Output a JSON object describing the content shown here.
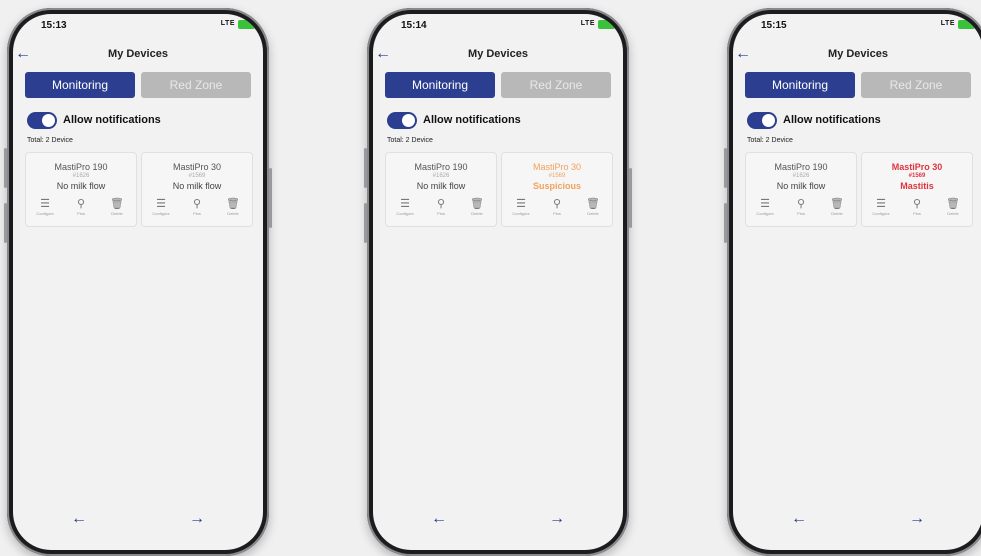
{
  "screens": [
    {
      "time": "15:13",
      "signal": "LTE",
      "title": "My Devices",
      "tabs": [
        "Monitoring",
        "Red Zone"
      ],
      "toggle_label": "Allow notifications",
      "total": "Total: 2 Device",
      "cards": [
        {
          "name": "MastiPro 190",
          "code": "#1626",
          "status": "No milk flow",
          "state": "normal"
        },
        {
          "name": "MastiPro 30",
          "code": "#1569",
          "status": "No milk flow",
          "state": "normal"
        }
      ]
    },
    {
      "time": "15:14",
      "signal": "LTE",
      "title": "My Devices",
      "tabs": [
        "Monitoring",
        "Red Zone"
      ],
      "toggle_label": "Allow notifications",
      "total": "Total: 2 Device",
      "cards": [
        {
          "name": "MastiPro 190",
          "code": "#1626",
          "status": "No milk flow",
          "state": "normal"
        },
        {
          "name": "MastiPro 30",
          "code": "#1569",
          "status": "Suspicious",
          "state": "suspicious"
        }
      ]
    },
    {
      "time": "15:15",
      "signal": "LTE",
      "title": "My Devices",
      "tabs": [
        "Monitoring",
        "Red Zone"
      ],
      "toggle_label": "Allow notifications",
      "total": "Total: 2 Device",
      "cards": [
        {
          "name": "MastiPro 190",
          "code": "#1626",
          "status": "No milk flow",
          "state": "normal"
        },
        {
          "name": "MastiPro 30",
          "code": "#1569",
          "status": "Mastitis",
          "state": "mastitis"
        }
      ]
    }
  ],
  "actions": [
    {
      "label": "Configure",
      "icon": "sliders-icon"
    },
    {
      "label": "Pins",
      "icon": "pin-icon"
    },
    {
      "label": "Delete",
      "icon": "trash-icon"
    }
  ],
  "colors": {
    "accent": "#2c3e8f",
    "suspicious": "#f0a25a",
    "mastitis": "#e0343f",
    "battery": "#3ac23a"
  }
}
